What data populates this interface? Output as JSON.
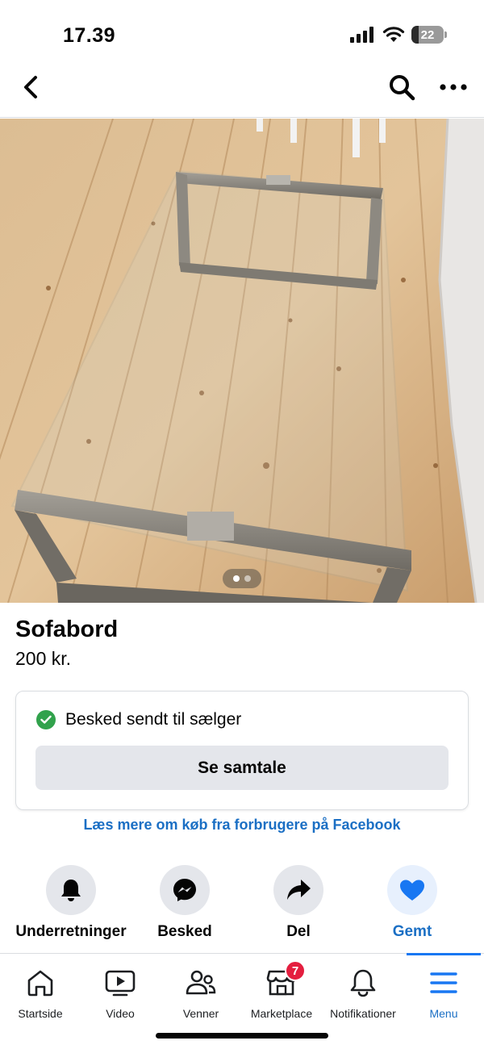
{
  "status_bar": {
    "time": "17.39",
    "battery_level": "22",
    "battery_fraction": 0.22
  },
  "nav": {
    "back_icon": "chevron-left-icon",
    "search_icon": "search-icon",
    "more_icon": "more-horizontal-icon"
  },
  "photo": {
    "current_index": 1,
    "total": 2
  },
  "listing": {
    "title": "Sofabord",
    "price": "200 kr."
  },
  "message_card": {
    "status": "Besked sendt til sælger",
    "button": "Se samtale"
  },
  "learn_more_link": "Læs mere om køb fra forbrugere på Facebook",
  "actions": [
    {
      "label": "Underretninger",
      "icon": "bell-icon"
    },
    {
      "label": "Besked",
      "icon": "messenger-icon"
    },
    {
      "label": "Del",
      "icon": "share-icon"
    },
    {
      "label": "Gemt",
      "icon": "heart-icon",
      "active": true
    }
  ],
  "tabs": [
    {
      "label": "Startside",
      "icon": "home-icon"
    },
    {
      "label": "Video",
      "icon": "video-icon"
    },
    {
      "label": "Venner",
      "icon": "friends-icon"
    },
    {
      "label": "Marketplace",
      "icon": "marketplace-icon",
      "badge": "7"
    },
    {
      "label": "Notifikationer",
      "icon": "bell-icon"
    },
    {
      "label": "Menu",
      "icon": "menu-icon",
      "active": true
    }
  ],
  "colors": {
    "accent": "#1877f2",
    "link": "#1b6fc4",
    "success": "#31a24c",
    "badge": "#e41e3f"
  }
}
